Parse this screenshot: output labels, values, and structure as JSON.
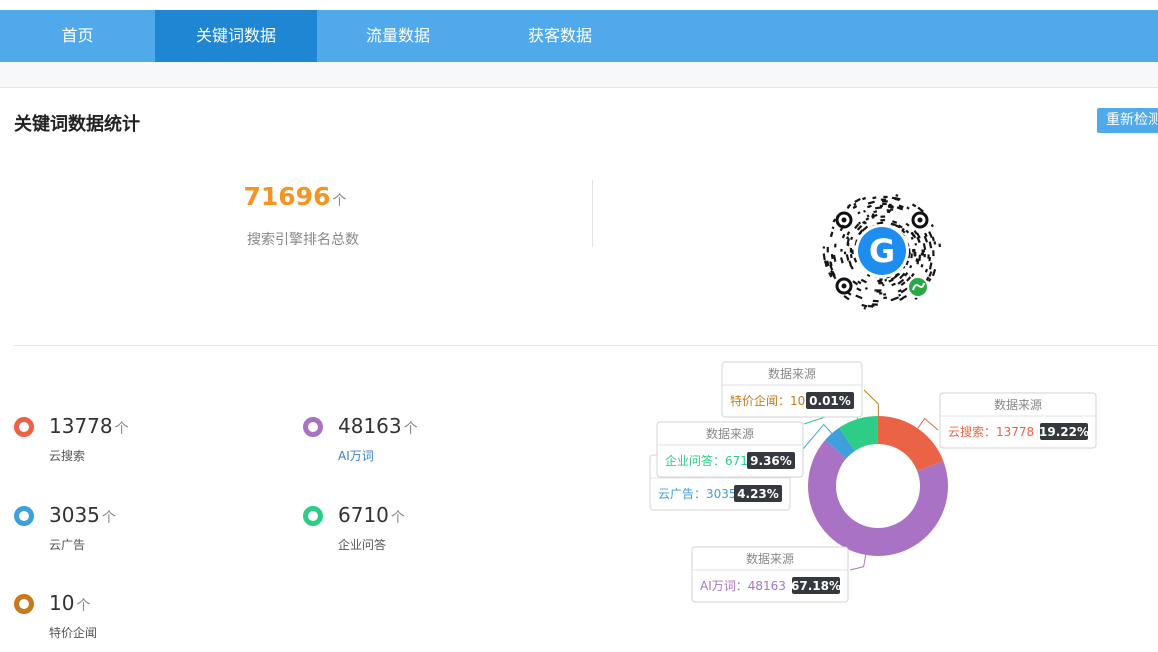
{
  "nav": {
    "items": [
      {
        "label": "首页",
        "active": false
      },
      {
        "label": "关键词数据",
        "active": true
      },
      {
        "label": "流量数据",
        "active": false
      },
      {
        "label": "获客数据",
        "active": false
      }
    ]
  },
  "section": {
    "title": "关键词数据统计",
    "recheck_label": "重新检测"
  },
  "summary": {
    "total": "71696",
    "unit": "个",
    "label": "搜索引擎排名总数"
  },
  "qrcode": {
    "icon": "mini-program-qr-code-icon",
    "logo_letter": "G"
  },
  "stats": [
    {
      "value": "13778",
      "unit": "个",
      "label": "云搜索",
      "color": "#ea6347"
    },
    {
      "value": "48163",
      "unit": "个",
      "label": "AI万词",
      "color": "#a972c4"
    },
    {
      "value": "3035",
      "unit": "个",
      "label": "云广告",
      "color": "#3da0dc"
    },
    {
      "value": "6710",
      "unit": "个",
      "label": "企业问答",
      "color": "#2ecc87"
    },
    {
      "value": "10",
      "unit": "个",
      "label": "特价企闻",
      "color": "#c77a1d"
    }
  ],
  "chart_data": {
    "type": "pie",
    "variant": "donut",
    "tooltip_title": "数据来源",
    "slices": [
      {
        "name": "云搜索",
        "value": 13778,
        "percent": "19.22%",
        "color": "#ea6347"
      },
      {
        "name": "AI万词",
        "value": 48163,
        "percent": "67.18%",
        "color": "#a972c4"
      },
      {
        "name": "云广告",
        "value": 3035,
        "percent": "4.23%",
        "color": "#3da0dc"
      },
      {
        "name": "企业问答",
        "value": 6710,
        "percent": "9.36%",
        "color": "#2ecc87"
      },
      {
        "name": "特价企闻",
        "value": 10,
        "percent": "0.01%",
        "color": "#c77a1d"
      }
    ]
  }
}
